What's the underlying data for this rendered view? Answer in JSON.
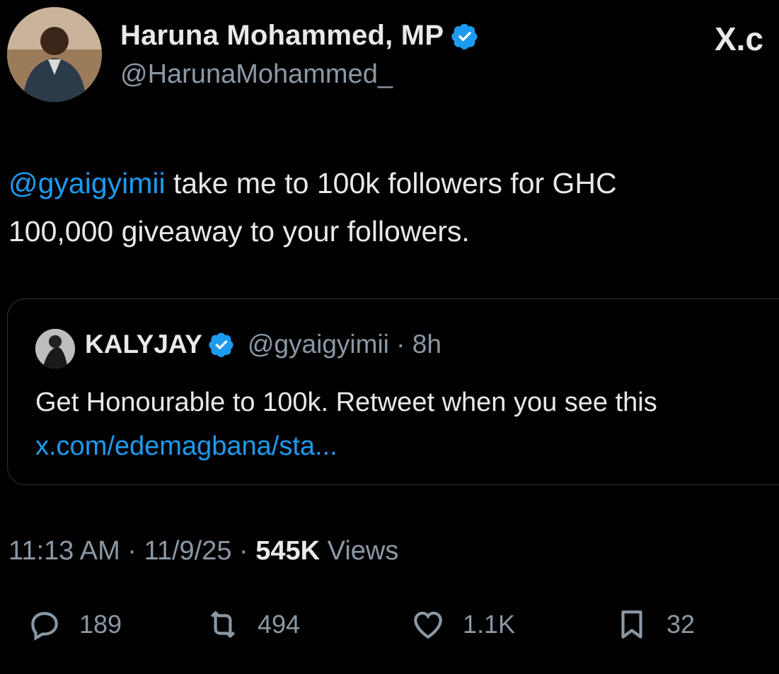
{
  "author": {
    "name": "Haruna Mohammed, MP",
    "handle": "@HarunaMohammed_",
    "verified_color": "#1d9bf0"
  },
  "brand": {
    "logo_text": "X.c"
  },
  "tweet": {
    "mention": "@gyaigyimii",
    "text_line1_rest": " take me to 100k followers for GHC",
    "text_line2": "100,000 giveaway to your followers."
  },
  "quoted": {
    "name": "KALYJAY",
    "handle": "@gyaigyimii",
    "separator": " · ",
    "age": "8h",
    "text": "Get Honourable to 100k. Retweet when you see this",
    "link": "x.com/edemagbana/sta..."
  },
  "meta": {
    "time": "11:13 AM",
    "date": "11/9/25",
    "sep": " · ",
    "views_count": "545K",
    "views_label": " Views"
  },
  "actions": {
    "replies": "189",
    "retweets": "494",
    "likes": "1.1K",
    "bookmarks": "32"
  },
  "colors": {
    "background": "#000000",
    "text": "#e7e9ea",
    "secondary": "#8b98a5",
    "accent": "#1d9bf0",
    "border": "#2f3336"
  }
}
